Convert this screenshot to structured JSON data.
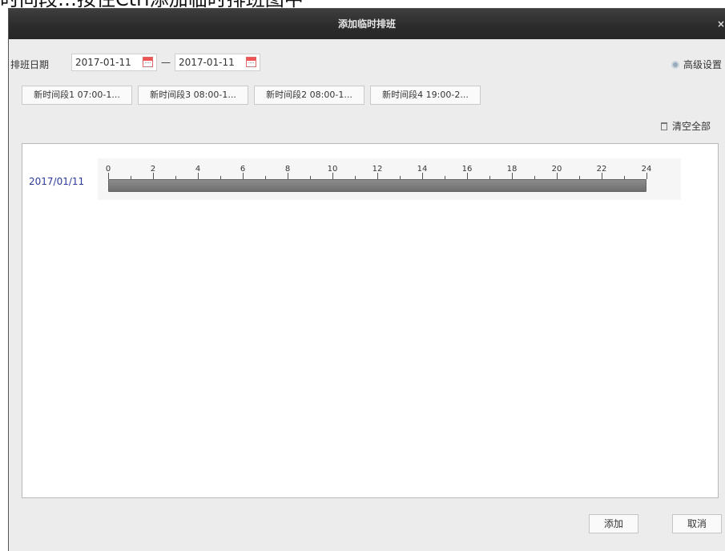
{
  "caption": "时间段…按住Ctrl添加临时排班图中",
  "dialog": {
    "title": "添加临时排班",
    "close": "×"
  },
  "date_row": {
    "label": "排班日期",
    "start_date": "2017-01-11",
    "separator": "—",
    "end_date": "2017-01-11",
    "advanced_label": "高级设置"
  },
  "periods": [
    "新时间段1 07:00-1...",
    "新时间段3 08:00-1...",
    "新时间段2 08:00-1...",
    "新时间段4 19:00-2..."
  ],
  "clear_all": "清空全部",
  "timeline": {
    "row_label": "2017/01/11",
    "tick_labels": [
      "0",
      "2",
      "4",
      "6",
      "8",
      "10",
      "12",
      "14",
      "16",
      "18",
      "20",
      "22",
      "24"
    ],
    "hour_start": 0,
    "hour_end": 24,
    "bar_start_hour": 0,
    "bar_end_hour": 24
  },
  "footer": {
    "add_label": "添加",
    "cancel_label": "取消"
  }
}
